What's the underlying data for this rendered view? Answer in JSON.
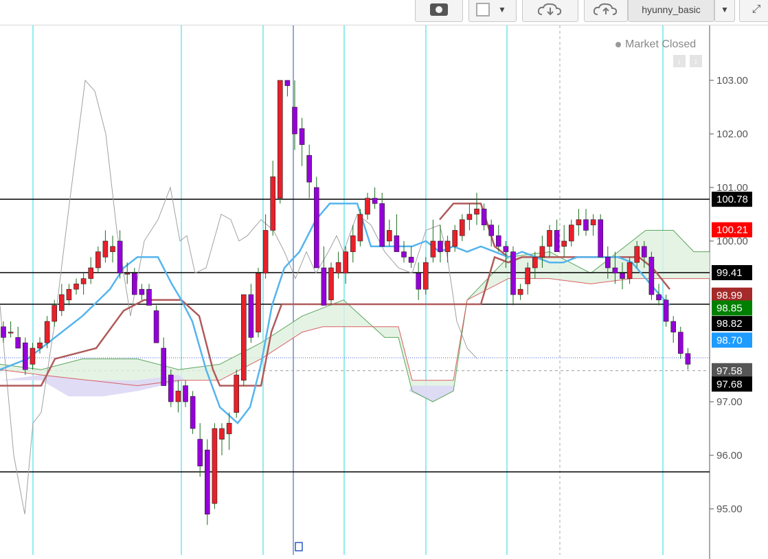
{
  "toolbar": {
    "layout_name": "hyunny_basic",
    "camera_icon": "camera-icon",
    "download_icon": "cloud-download-icon",
    "upload_icon": "cloud-upload-icon",
    "fullscreen_icon": "fullscreen-icon"
  },
  "status": {
    "market": "Market Closed"
  },
  "colors": {
    "bull": "#e8202a",
    "bear": "#9500d9",
    "blue_line": "#54b4ee",
    "red_line": "#b05a5a",
    "gray_line": "#a0a0a0",
    "cloud_green": "#dff0df",
    "cloud_purple": "#ddd8f5",
    "cycle_line": "#6fe6ea",
    "level_line": "#000000"
  },
  "chart_data": {
    "type": "candlestick",
    "title": "",
    "y_ticks": [
      "103.00",
      "102.00",
      "101.00",
      "100.00",
      "97.00",
      "96.00",
      "95.00"
    ],
    "ylim": [
      94.3,
      103.5
    ],
    "horizontal_levels": [
      100.78,
      99.41,
      98.82,
      95.69
    ],
    "price_labels": [
      {
        "text": "100.78",
        "value": 100.78,
        "bg": "#000000",
        "fg": "#ffffff"
      },
      {
        "text": "100.21",
        "value": 100.21,
        "bg": "#ff0000",
        "fg": "#ffffff"
      },
      {
        "text": "99.41",
        "value": 99.41,
        "bg": "#000000",
        "fg": "#ffffff"
      },
      {
        "text": "98.99",
        "value": 98.99,
        "bg": "#a52a2a",
        "fg": "#ffffff"
      },
      {
        "text": "98.85",
        "value": 98.75,
        "bg": "#008000",
        "fg": "#ffffff"
      },
      {
        "text": "98.82",
        "value": 98.46,
        "bg": "#000000",
        "fg": "#ffffff"
      },
      {
        "text": "98.70",
        "value": 98.15,
        "bg": "#1e9bff",
        "fg": "#ffffff"
      },
      {
        "text": "97.58",
        "value": 97.58,
        "bg": "#555555",
        "fg": "#ffffff"
      },
      {
        "text": "97.68",
        "value": 97.33,
        "bg": "#000000",
        "fg": "#ffffff"
      }
    ],
    "candles": [
      [
        98.4,
        98.5,
        98.1,
        98.2
      ],
      [
        98.3,
        98.5,
        98.2,
        98.3
      ],
      [
        98.2,
        98.4,
        98.0,
        98.0
      ],
      [
        98.1,
        98.2,
        97.5,
        97.6
      ],
      [
        97.7,
        98.1,
        97.6,
        98.0
      ],
      [
        98.0,
        98.2,
        97.9,
        98.1
      ],
      [
        98.1,
        98.6,
        98.0,
        98.5
      ],
      [
        98.5,
        98.9,
        98.4,
        98.8
      ],
      [
        98.7,
        99.2,
        98.6,
        99.0
      ],
      [
        98.9,
        99.2,
        98.8,
        99.1
      ],
      [
        99.1,
        99.3,
        99.0,
        99.2
      ],
      [
        99.2,
        99.4,
        99.0,
        99.3
      ],
      [
        99.3,
        99.7,
        99.2,
        99.5
      ],
      [
        99.5,
        99.9,
        99.4,
        99.8
      ],
      [
        99.7,
        100.2,
        99.6,
        100.0
      ],
      [
        99.8,
        100.1,
        99.6,
        99.9
      ],
      [
        100.0,
        100.2,
        99.3,
        99.4
      ],
      [
        99.4,
        99.6,
        99.2,
        99.4
      ],
      [
        99.4,
        99.5,
        99.0,
        99.0
      ],
      [
        99.1,
        99.2,
        98.9,
        99.0
      ],
      [
        99.1,
        99.2,
        98.8,
        98.8
      ],
      [
        98.7,
        98.8,
        98.2,
        98.1
      ],
      [
        98.0,
        98.2,
        97.3,
        97.3
      ],
      [
        97.5,
        97.6,
        96.9,
        97.0
      ],
      [
        97.0,
        97.4,
        96.8,
        97.2
      ],
      [
        97.3,
        97.4,
        96.9,
        97.0
      ],
      [
        97.1,
        97.2,
        96.4,
        96.5
      ],
      [
        96.3,
        96.6,
        95.6,
        95.8
      ],
      [
        96.1,
        96.3,
        94.7,
        94.9
      ],
      [
        95.1,
        96.6,
        95.0,
        96.5
      ],
      [
        96.3,
        96.6,
        96.0,
        96.5
      ],
      [
        96.4,
        96.8,
        96.1,
        96.6
      ],
      [
        96.8,
        97.6,
        96.7,
        97.5
      ],
      [
        97.4,
        98.9,
        97.3,
        99.0
      ],
      [
        99.0,
        99.2,
        98.1,
        98.2
      ],
      [
        98.3,
        99.5,
        98.2,
        99.4
      ],
      [
        99.4,
        100.5,
        99.3,
        100.2
      ],
      [
        100.2,
        101.5,
        100.1,
        101.2
      ],
      [
        100.8,
        103.0,
        100.7,
        103.0
      ],
      [
        103.0,
        103.0,
        102.7,
        102.9
      ],
      [
        102.5,
        103.0,
        101.7,
        102.0
      ],
      [
        102.1,
        102.3,
        101.4,
        101.8
      ],
      [
        101.6,
        101.8,
        100.8,
        101.1
      ],
      [
        101.0,
        101.2,
        99.5,
        99.5
      ],
      [
        99.5,
        99.9,
        98.8,
        98.8
      ],
      [
        98.9,
        99.6,
        98.8,
        99.5
      ],
      [
        99.4,
        99.8,
        99.3,
        99.6
      ],
      [
        99.4,
        99.9,
        99.2,
        99.8
      ],
      [
        99.8,
        100.3,
        99.6,
        100.1
      ],
      [
        100.0,
        100.6,
        99.9,
        100.5
      ],
      [
        100.5,
        100.9,
        100.4,
        100.8
      ],
      [
        100.8,
        101.0,
        100.6,
        100.7
      ],
      [
        100.7,
        100.9,
        99.9,
        99.9
      ],
      [
        100.0,
        100.4,
        99.9,
        100.2
      ],
      [
        100.1,
        100.5,
        99.8,
        99.8
      ],
      [
        99.8,
        100.0,
        99.6,
        99.7
      ],
      [
        99.7,
        99.9,
        99.5,
        99.6
      ],
      [
        99.4,
        99.6,
        98.9,
        99.1
      ],
      [
        99.1,
        99.7,
        99.0,
        99.6
      ],
      [
        99.7,
        100.4,
        99.6,
        100.0
      ],
      [
        100.0,
        100.3,
        99.6,
        99.8
      ],
      [
        99.8,
        100.1,
        99.6,
        100.0
      ],
      [
        99.9,
        100.3,
        99.8,
        100.2
      ],
      [
        100.1,
        100.5,
        100.0,
        100.4
      ],
      [
        100.4,
        100.7,
        100.2,
        100.5
      ],
      [
        100.5,
        100.9,
        100.3,
        100.6
      ],
      [
        100.6,
        100.7,
        100.2,
        100.3
      ],
      [
        100.3,
        100.4,
        99.9,
        100.1
      ],
      [
        100.1,
        100.3,
        99.8,
        99.9
      ],
      [
        99.9,
        100.0,
        99.5,
        99.8
      ],
      [
        99.8,
        99.9,
        98.8,
        99.0
      ],
      [
        99.0,
        99.2,
        98.9,
        99.1
      ],
      [
        99.2,
        99.6,
        99.0,
        99.5
      ],
      [
        99.5,
        99.8,
        99.3,
        99.7
      ],
      [
        99.7,
        100.1,
        99.5,
        99.9
      ],
      [
        99.9,
        100.3,
        99.7,
        100.2
      ],
      [
        100.2,
        100.4,
        99.8,
        99.8
      ],
      [
        99.9,
        100.3,
        99.7,
        100.0
      ],
      [
        100.0,
        100.4,
        99.9,
        100.3
      ],
      [
        100.3,
        100.6,
        100.1,
        100.4
      ],
      [
        100.4,
        100.6,
        100.1,
        100.2
      ],
      [
        100.3,
        100.5,
        100.1,
        100.4
      ],
      [
        100.4,
        100.5,
        99.9,
        99.7
      ],
      [
        99.7,
        99.9,
        99.3,
        99.5
      ],
      [
        99.5,
        99.8,
        99.2,
        99.4
      ],
      [
        99.4,
        99.6,
        99.1,
        99.3
      ],
      [
        99.3,
        99.7,
        99.2,
        99.6
      ],
      [
        99.6,
        100.0,
        99.5,
        99.9
      ],
      [
        99.9,
        100.0,
        99.5,
        99.7
      ],
      [
        99.7,
        99.8,
        98.9,
        99.0
      ],
      [
        99.0,
        99.2,
        98.8,
        98.9
      ],
      [
        98.9,
        99.0,
        98.4,
        98.5
      ],
      [
        98.5,
        98.6,
        98.1,
        98.3
      ],
      [
        98.3,
        98.4,
        97.8,
        97.9
      ],
      [
        97.9,
        98.0,
        97.6,
        97.7
      ]
    ]
  }
}
